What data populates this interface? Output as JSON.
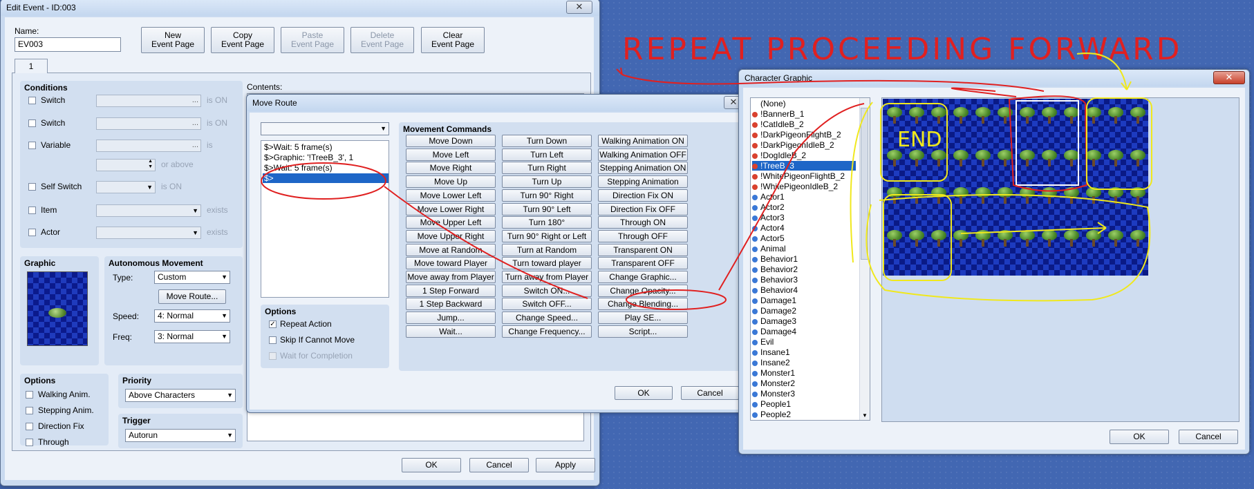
{
  "edit_event": {
    "title": "Edit Event - ID:003",
    "close": "✕",
    "name_label": "Name:",
    "name_value": "EV003",
    "buttons": {
      "new": "New\nEvent Page",
      "copy": "Copy\nEvent Page",
      "paste": "Paste\nEvent Page",
      "delete": "Delete\nEvent Page",
      "clear": "Clear\nEvent Page"
    },
    "tab": "1",
    "conditions": {
      "title": "Conditions",
      "switch1": "Switch",
      "switch2": "Switch",
      "variable": "Variable",
      "self_switch": "Self Switch",
      "item": "Item",
      "actor": "Actor",
      "is_on": "is ON",
      "is": "is",
      "or_above": "or above",
      "exists": "exists",
      "dots": "..."
    },
    "contents_label": "Contents:",
    "graphic_title": "Graphic",
    "autonomous": {
      "title": "Autonomous Movement",
      "type_label": "Type:",
      "type_value": "Custom",
      "move_route_btn": "Move Route...",
      "speed_label": "Speed:",
      "speed_value": "4: Normal",
      "freq_label": "Freq:",
      "freq_value": "3: Normal"
    },
    "options": {
      "title": "Options",
      "walking": "Walking Anim.",
      "stepping": "Stepping Anim.",
      "direction": "Direction Fix",
      "through": "Through"
    },
    "priority": {
      "title": "Priority",
      "value": "Above Characters"
    },
    "trigger": {
      "title": "Trigger",
      "value": "Autorun"
    },
    "footer": {
      "ok": "OK",
      "cancel": "Cancel",
      "apply": "Apply"
    }
  },
  "move_route": {
    "title": "Move Route",
    "list": [
      "$>Wait: 5 frame(s)",
      "$>Graphic: '!TreeB_3', 1",
      "$>Wait: 5 frame(s)",
      "$>"
    ],
    "options": {
      "title": "Options",
      "repeat": "Repeat Action",
      "skip": "Skip If Cannot Move",
      "wait": "Wait for Completion"
    },
    "commands_title": "Movement Commands",
    "col1": [
      "Move Down",
      "Move Left",
      "Move Right",
      "Move Up",
      "Move Lower Left",
      "Move Lower Right",
      "Move Upper Left",
      "Move Upper Right",
      "Move at Random",
      "Move toward Player",
      "Move away from Player",
      "1 Step Forward",
      "1 Step Backward",
      "Jump...",
      "Wait..."
    ],
    "col2": [
      "Turn Down",
      "Turn Left",
      "Turn Right",
      "Turn Up",
      "Turn 90° Right",
      "Turn 90° Left",
      "Turn 180°",
      "Turn 90° Right or Left",
      "Turn at Random",
      "Turn toward player",
      "Turn away from Player",
      "Switch ON...",
      "Switch OFF...",
      "Change Speed...",
      "Change Frequency..."
    ],
    "col3": [
      "Walking Animation ON",
      "Walking Animation OFF",
      "Stepping Animation ON",
      "Stepping Animation OFF",
      "Direction Fix ON",
      "Direction Fix OFF",
      "Through ON",
      "Through OFF",
      "Transparent ON",
      "Transparent OFF",
      "Change Graphic...",
      "Change Opacity...",
      "Change Blending...",
      "Play SE...",
      "Script..."
    ],
    "ok": "OK",
    "cancel": "Cancel",
    "close": "✕"
  },
  "character_graphic": {
    "title": "Character Graphic",
    "close": "✕",
    "files": [
      {
        "name": "(None)",
        "color": ""
      },
      {
        "name": "!BannerB_1",
        "color": "#d9412e"
      },
      {
        "name": "!CatIdleB_2",
        "color": "#d9412e"
      },
      {
        "name": "!DarkPigeonFlightB_2",
        "color": "#d9412e"
      },
      {
        "name": "!DarkPigeonIdleB_2",
        "color": "#d9412e"
      },
      {
        "name": "!DogIdleB_2",
        "color": "#d9412e"
      },
      {
        "name": "!TreeB_3",
        "color": "#d9412e",
        "selected": true
      },
      {
        "name": "!WhitePigeonFlightB_2",
        "color": "#d9412e"
      },
      {
        "name": "!WhitePigeonIdleB_2",
        "color": "#d9412e"
      },
      {
        "name": "Actor1",
        "color": "#3a78d6"
      },
      {
        "name": "Actor2",
        "color": "#3a78d6"
      },
      {
        "name": "Actor3",
        "color": "#3a78d6"
      },
      {
        "name": "Actor4",
        "color": "#3a78d6"
      },
      {
        "name": "Actor5",
        "color": "#3a78d6"
      },
      {
        "name": "Animal",
        "color": "#3a78d6"
      },
      {
        "name": "Behavior1",
        "color": "#3a78d6"
      },
      {
        "name": "Behavior2",
        "color": "#3a78d6"
      },
      {
        "name": "Behavior3",
        "color": "#3a78d6"
      },
      {
        "name": "Behavior4",
        "color": "#3a78d6"
      },
      {
        "name": "Damage1",
        "color": "#3a78d6"
      },
      {
        "name": "Damage2",
        "color": "#3a78d6"
      },
      {
        "name": "Damage3",
        "color": "#3a78d6"
      },
      {
        "name": "Damage4",
        "color": "#3a78d6"
      },
      {
        "name": "Evil",
        "color": "#3a78d6"
      },
      {
        "name": "Insane1",
        "color": "#3a78d6"
      },
      {
        "name": "Insane2",
        "color": "#3a78d6"
      },
      {
        "name": "Monster1",
        "color": "#3a78d6"
      },
      {
        "name": "Monster2",
        "color": "#3a78d6"
      },
      {
        "name": "Monster3",
        "color": "#3a78d6"
      },
      {
        "name": "People1",
        "color": "#3a78d6"
      },
      {
        "name": "People2",
        "color": "#3a78d6"
      }
    ],
    "ok": "OK",
    "cancel": "Cancel"
  },
  "annotations": {
    "heading": "REPEAT PROCEEDING FORWARD",
    "end_label": "END",
    "red": "#e02020",
    "yellow": "#f0e81c"
  }
}
